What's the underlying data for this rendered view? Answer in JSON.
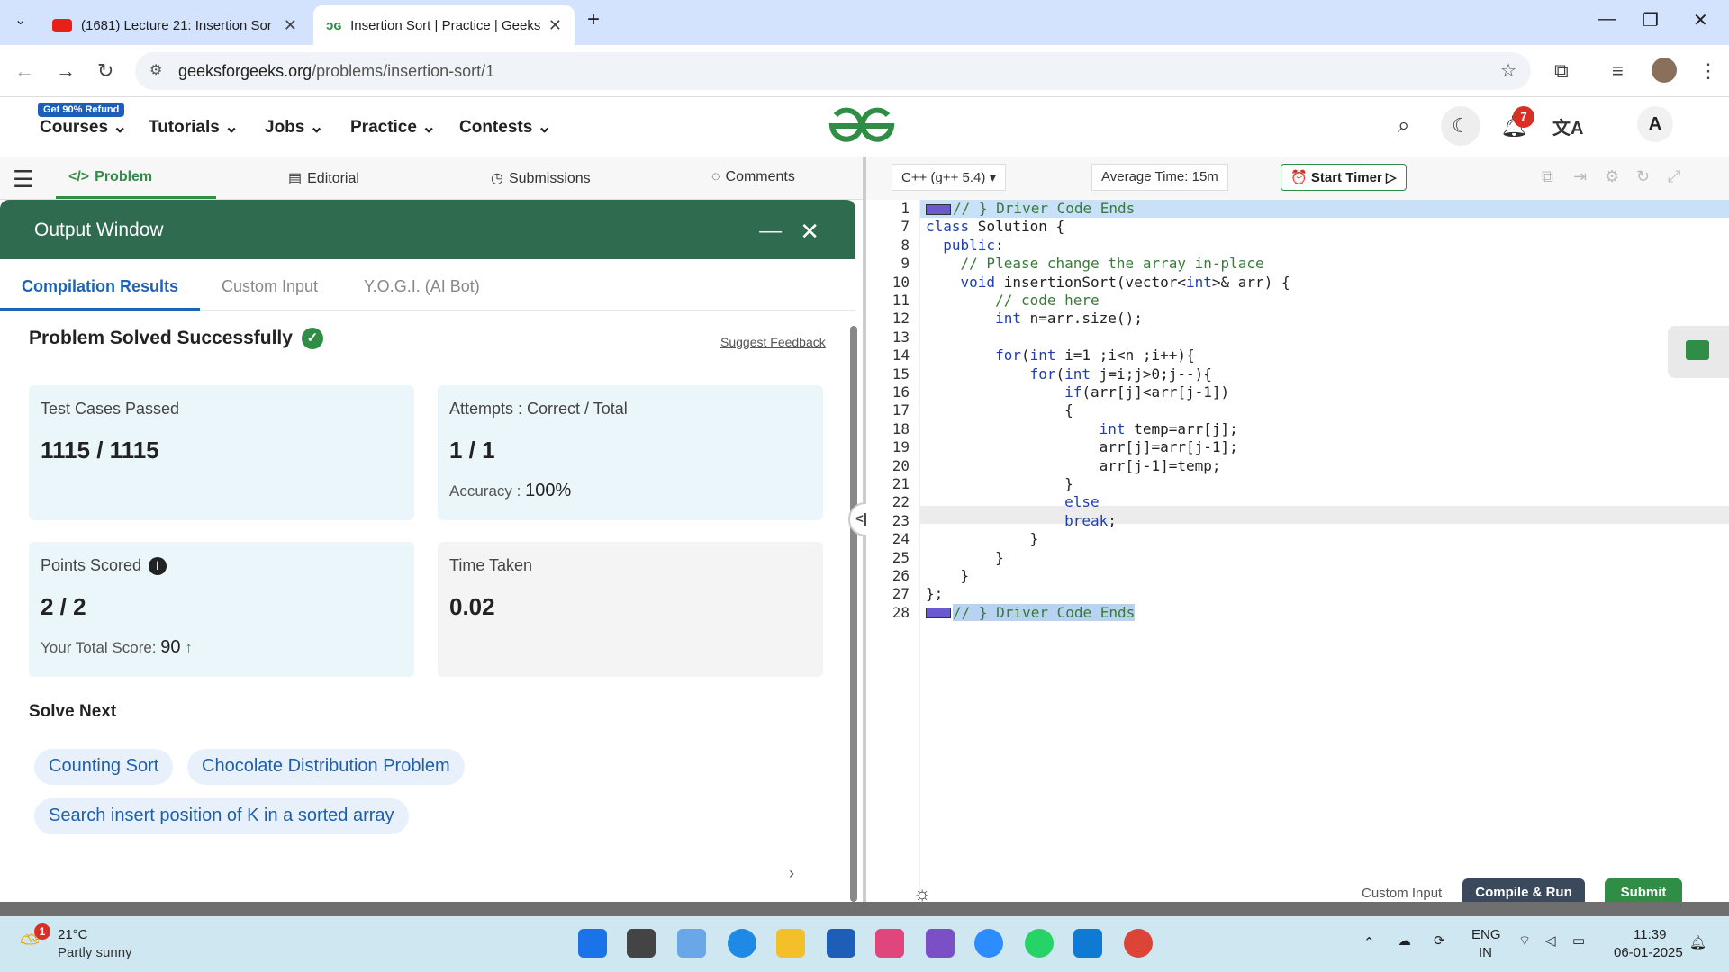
{
  "browser": {
    "tabs": [
      {
        "title": "(1681) Lecture 21: Insertion Sor"
      },
      {
        "title": "Insertion Sort | Practice | Geeks"
      }
    ],
    "url_domain": "geeksforgeeks.org",
    "url_path": "/problems/insertion-sort/1"
  },
  "header": {
    "refund_badge": "Get 90% Refund",
    "nav": [
      "Courses",
      "Tutorials",
      "Jobs",
      "Practice",
      "Contests"
    ],
    "notification_count": "7",
    "avatar_initial": "A"
  },
  "problem_tabs": [
    "Problem",
    "Editorial",
    "Submissions",
    "Comments"
  ],
  "output": {
    "title": "Output Window",
    "tabs": [
      "Compilation Results",
      "Custom Input",
      "Y.O.G.I. (AI Bot)"
    ],
    "status": "Problem Solved Successfully",
    "feedback": "Suggest Feedback",
    "cards": {
      "tests_label": "Test Cases Passed",
      "tests_value": "1115 / 1115",
      "attempts_label": "Attempts : Correct / Total",
      "attempts_value": "1 / 1",
      "accuracy_label": "Accuracy :",
      "accuracy_value": "100%",
      "points_label": "Points Scored",
      "points_value": "2 / 2",
      "total_label": "Your Total Score:",
      "total_value": "90",
      "time_label": "Time Taken",
      "time_value": "0.02"
    },
    "solve_next_label": "Solve Next",
    "solve_next": [
      "Counting Sort",
      "Chocolate Distribution Problem",
      "Search insert position of K in a sorted array"
    ]
  },
  "editor": {
    "language": "C++ (g++ 5.4)",
    "avg_time": "Average Time: 15m",
    "timer": "Start Timer",
    "line_numbers": [
      "1",
      "7",
      "8",
      "9",
      "10",
      "11",
      "12",
      "13",
      "14",
      "15",
      "16",
      "17",
      "18",
      "19",
      "20",
      "21",
      "22",
      "23",
      "24",
      "25",
      "26",
      "27",
      "28"
    ],
    "lines": [
      "// } Driver Code Ends",
      "class Solution {",
      "  public:",
      "    // Please change the array in-place",
      "    void insertionSort(vector<int>& arr) {",
      "        // code here",
      "        int n=arr.size();",
      "",
      "        for(int i=1 ;i<n ;i++){",
      "            for(int j=i;j>0;j--){",
      "                if(arr[j]<arr[j-1])",
      "                {",
      "                    int temp=arr[j];",
      "                    arr[j]=arr[j-1];",
      "                    arr[j-1]=temp;",
      "                }",
      "                else",
      "                break;",
      "            }",
      "        }",
      "    }",
      "};",
      "// } Driver Code Ends"
    ],
    "custom_input": "Custom Input",
    "compile_run": "Compile & Run",
    "submit": "Submit"
  },
  "taskbar": {
    "temp": "21°C",
    "weather": "Partly sunny",
    "weather_badge": "1",
    "lang_top": "ENG",
    "lang_bottom": "IN",
    "time": "11:39",
    "date": "06-01-2025"
  },
  "colors": {
    "gfg_green": "#2f8d46",
    "output_header": "#2e6b4f",
    "accent_blue": "#1e63b5"
  }
}
